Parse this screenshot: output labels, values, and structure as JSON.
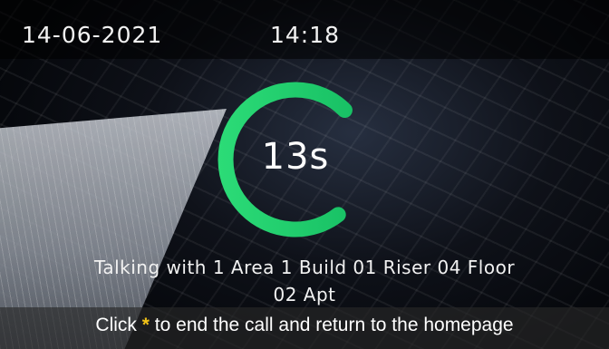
{
  "status_bar": {
    "date": "14-06-2021",
    "time": "14:18"
  },
  "call": {
    "timer": "13s",
    "progress_ratio": 0.73,
    "ring_color": "#1fcf6e",
    "talking_line1": "Talking with 1 Area 1 Build 01 Riser 04 Floor",
    "talking_line2": "02 Apt"
  },
  "hint": {
    "prefix": "Click",
    "key": "*",
    "suffix": "to end the call and return to the homepage",
    "key_color": "#f2c318"
  }
}
